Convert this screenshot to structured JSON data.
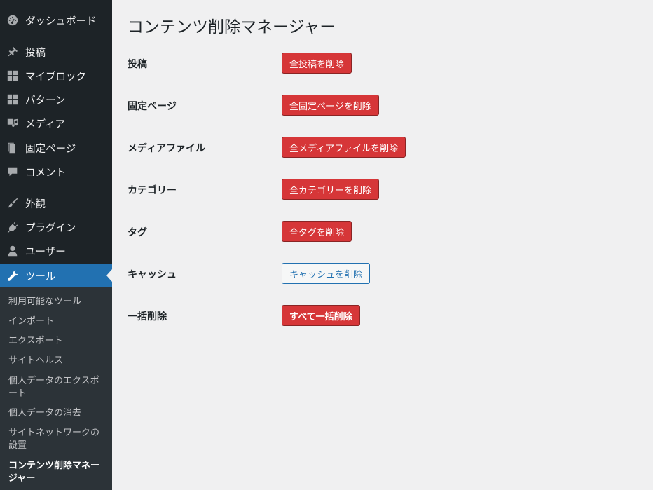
{
  "sidebar": {
    "items": [
      {
        "label": "ダッシュボード",
        "icon": "dashboard-icon"
      },
      {
        "label": "投稿",
        "icon": "pin-icon"
      },
      {
        "label": "マイブロック",
        "icon": "blocks-icon"
      },
      {
        "label": "パターン",
        "icon": "patterns-icon"
      },
      {
        "label": "メディア",
        "icon": "media-icon"
      },
      {
        "label": "固定ページ",
        "icon": "page-icon"
      },
      {
        "label": "コメント",
        "icon": "comment-icon"
      },
      {
        "label": "外観",
        "icon": "paintbrush-icon"
      },
      {
        "label": "プラグイン",
        "icon": "plugin-icon"
      },
      {
        "label": "ユーザー",
        "icon": "user-icon"
      },
      {
        "label": "ツール",
        "icon": "wrench-icon"
      }
    ],
    "submenu": [
      {
        "label": "利用可能なツール"
      },
      {
        "label": "インポート"
      },
      {
        "label": "エクスポート"
      },
      {
        "label": "サイトヘルス"
      },
      {
        "label": "個人データのエクスポート"
      },
      {
        "label": "個人データの消去"
      },
      {
        "label": "サイトネットワークの設置"
      },
      {
        "label": "コンテンツ削除マネージャー"
      }
    ]
  },
  "main": {
    "title": "コンテンツ削除マネージャー",
    "rows": [
      {
        "label": "投稿",
        "button": "全投稿を削除"
      },
      {
        "label": "固定ページ",
        "button": "全固定ページを削除"
      },
      {
        "label": "メディアファイル",
        "button": "全メディアファイルを削除"
      },
      {
        "label": "カテゴリー",
        "button": "全カテゴリーを削除"
      },
      {
        "label": "タグ",
        "button": "全タグを削除"
      },
      {
        "label": "キャッシュ",
        "button": "キャッシュを削除"
      },
      {
        "label": "一括削除",
        "button": "すべて一括削除"
      }
    ]
  },
  "colors": {
    "sidebar_bg": "#1d2327",
    "submenu_bg": "#2c3338",
    "active": "#2271b1",
    "danger": "#d63638",
    "page_bg": "#f0f0f1"
  }
}
